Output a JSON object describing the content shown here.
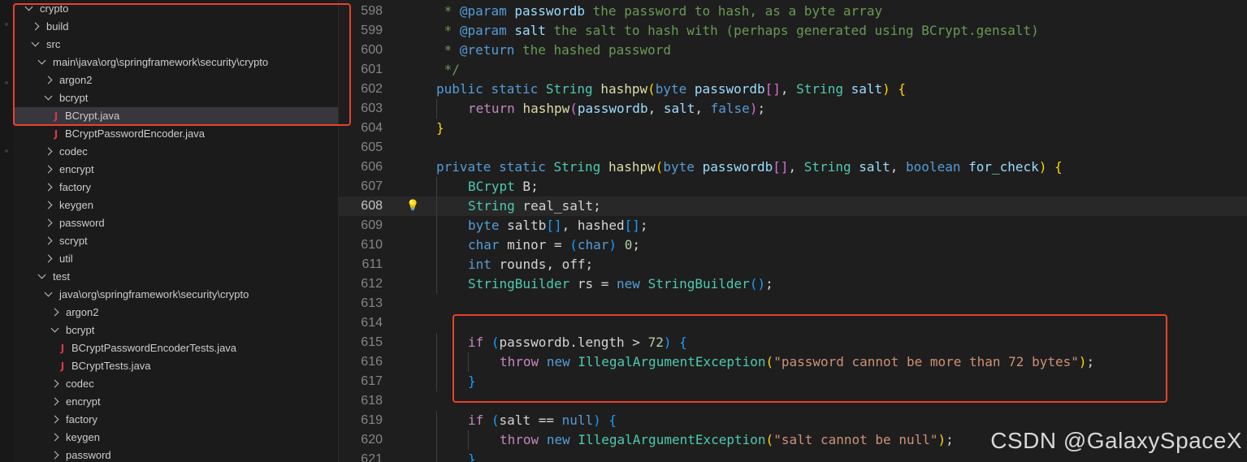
{
  "explorer": {
    "items": [
      {
        "label": "crypto",
        "indent": 0,
        "kind": "folder",
        "open": true
      },
      {
        "label": "build",
        "indent": 1,
        "kind": "folder",
        "open": false
      },
      {
        "label": "src",
        "indent": 1,
        "kind": "folder",
        "open": true
      },
      {
        "label": "main\\java\\org\\springframework\\security\\crypto",
        "indent": 2,
        "kind": "folder",
        "open": true
      },
      {
        "label": "argon2",
        "indent": 3,
        "kind": "folder",
        "open": false
      },
      {
        "label": "bcrypt",
        "indent": 3,
        "kind": "folder",
        "open": true
      },
      {
        "label": "BCrypt.java",
        "indent": 4,
        "kind": "java",
        "selected": true
      },
      {
        "label": "BCryptPasswordEncoder.java",
        "indent": 4,
        "kind": "java"
      },
      {
        "label": "codec",
        "indent": 3,
        "kind": "folder",
        "open": false
      },
      {
        "label": "encrypt",
        "indent": 3,
        "kind": "folder",
        "open": false
      },
      {
        "label": "factory",
        "indent": 3,
        "kind": "folder",
        "open": false
      },
      {
        "label": "keygen",
        "indent": 3,
        "kind": "folder",
        "open": false
      },
      {
        "label": "password",
        "indent": 3,
        "kind": "folder",
        "open": false
      },
      {
        "label": "scrypt",
        "indent": 3,
        "kind": "folder",
        "open": false
      },
      {
        "label": "util",
        "indent": 3,
        "kind": "folder",
        "open": false
      },
      {
        "label": "test",
        "indent": 2,
        "kind": "folder",
        "open": true
      },
      {
        "label": "java\\org\\springframework\\security\\crypto",
        "indent": 3,
        "kind": "folder",
        "open": true
      },
      {
        "label": "argon2",
        "indent": 4,
        "kind": "folder",
        "open": false
      },
      {
        "label": "bcrypt",
        "indent": 4,
        "kind": "folder",
        "open": true
      },
      {
        "label": "BCryptPasswordEncoderTests.java",
        "indent": 5,
        "kind": "java"
      },
      {
        "label": "BCryptTests.java",
        "indent": 5,
        "kind": "java"
      },
      {
        "label": "codec",
        "indent": 4,
        "kind": "folder",
        "open": false
      },
      {
        "label": "encrypt",
        "indent": 4,
        "kind": "folder",
        "open": false
      },
      {
        "label": "factory",
        "indent": 4,
        "kind": "folder",
        "open": false
      },
      {
        "label": "keygen",
        "indent": 4,
        "kind": "folder",
        "open": false
      },
      {
        "label": "password",
        "indent": 4,
        "kind": "folder",
        "open": false
      }
    ]
  },
  "editor": {
    "current_line": 608,
    "lines": [
      {
        "n": 598,
        "indent": 0,
        "tokens": [
          [
            "cmt",
            " * "
          ],
          [
            "tag",
            "@param"
          ],
          [
            "pm",
            " passwordb"
          ],
          [
            "cmt",
            " the password to hash, as a byte array"
          ]
        ]
      },
      {
        "n": 599,
        "indent": 0,
        "tokens": [
          [
            "cmt",
            " * "
          ],
          [
            "tag",
            "@param"
          ],
          [
            "pm",
            " salt"
          ],
          [
            "cmt",
            " the salt to hash with (perhaps generated using BCrypt.gensalt)"
          ]
        ]
      },
      {
        "n": 600,
        "indent": 0,
        "tokens": [
          [
            "cmt",
            " * "
          ],
          [
            "tag",
            "@return"
          ],
          [
            "cmt",
            " the hashed password"
          ]
        ]
      },
      {
        "n": 601,
        "indent": 0,
        "tokens": [
          [
            "cmt",
            " */"
          ]
        ]
      },
      {
        "n": 602,
        "indent": 0,
        "tokens": [
          [
            "kw",
            "public"
          ],
          [
            "pun",
            " "
          ],
          [
            "kw",
            "static"
          ],
          [
            "pun",
            " "
          ],
          [
            "ty",
            "String"
          ],
          [
            "pun",
            " "
          ],
          [
            "fn",
            "hashpw"
          ],
          [
            "b1",
            "("
          ],
          [
            "kw",
            "byte"
          ],
          [
            "pun",
            " "
          ],
          [
            "var",
            "passwordb"
          ],
          [
            "b2",
            "[]"
          ],
          [
            "pun",
            ", "
          ],
          [
            "ty",
            "String"
          ],
          [
            "pun",
            " "
          ],
          [
            "var",
            "salt"
          ],
          [
            "b1",
            ")"
          ],
          [
            "pun",
            " "
          ],
          [
            "b1",
            "{"
          ]
        ]
      },
      {
        "n": 603,
        "indent": 1,
        "tokens": [
          [
            "ctrl",
            "return"
          ],
          [
            "pun",
            " "
          ],
          [
            "fn",
            "hashpw"
          ],
          [
            "b2",
            "("
          ],
          [
            "var",
            "passwordb"
          ],
          [
            "pun",
            ", "
          ],
          [
            "var",
            "salt"
          ],
          [
            "pun",
            ", "
          ],
          [
            "kw",
            "false"
          ],
          [
            "b2",
            ")"
          ],
          [
            "pun",
            ";"
          ]
        ]
      },
      {
        "n": 604,
        "indent": 0,
        "tokens": [
          [
            "b1",
            "}"
          ]
        ]
      },
      {
        "n": 605,
        "indent": 0,
        "tokens": []
      },
      {
        "n": 606,
        "indent": 0,
        "tokens": [
          [
            "kw",
            "private"
          ],
          [
            "pun",
            " "
          ],
          [
            "kw",
            "static"
          ],
          [
            "pun",
            " "
          ],
          [
            "ty",
            "String"
          ],
          [
            "pun",
            " "
          ],
          [
            "fn",
            "hashpw"
          ],
          [
            "b1",
            "("
          ],
          [
            "kw",
            "byte"
          ],
          [
            "pun",
            " "
          ],
          [
            "var",
            "passwordb"
          ],
          [
            "b2",
            "[]"
          ],
          [
            "pun",
            ", "
          ],
          [
            "ty",
            "String"
          ],
          [
            "pun",
            " "
          ],
          [
            "var",
            "salt"
          ],
          [
            "pun",
            ", "
          ],
          [
            "kw",
            "boolean"
          ],
          [
            "pun",
            " "
          ],
          [
            "var",
            "for_check"
          ],
          [
            "b1",
            ")"
          ],
          [
            "pun",
            " "
          ],
          [
            "b1",
            "{"
          ]
        ]
      },
      {
        "n": 607,
        "indent": 1,
        "tokens": [
          [
            "ty",
            "BCrypt"
          ],
          [
            "pun",
            " B;"
          ]
        ]
      },
      {
        "n": 608,
        "indent": 1,
        "tokens": [
          [
            "ty",
            "String"
          ],
          [
            "pun",
            " real_salt;"
          ]
        ]
      },
      {
        "n": 609,
        "indent": 1,
        "tokens": [
          [
            "kw",
            "byte"
          ],
          [
            "pun",
            " saltb"
          ],
          [
            "b3",
            "[]"
          ],
          [
            "pun",
            ", hashed"
          ],
          [
            "b3",
            "[]"
          ],
          [
            "pun",
            ";"
          ]
        ]
      },
      {
        "n": 610,
        "indent": 1,
        "tokens": [
          [
            "kw",
            "char"
          ],
          [
            "pun",
            " minor = "
          ],
          [
            "b3",
            "("
          ],
          [
            "kw",
            "char"
          ],
          [
            "b3",
            ")"
          ],
          [
            "pun",
            " "
          ],
          [
            "num",
            "0"
          ],
          [
            "pun",
            ";"
          ]
        ]
      },
      {
        "n": 611,
        "indent": 1,
        "tokens": [
          [
            "kw",
            "int"
          ],
          [
            "pun",
            " rounds, off;"
          ]
        ]
      },
      {
        "n": 612,
        "indent": 1,
        "tokens": [
          [
            "ty",
            "StringBuilder"
          ],
          [
            "pun",
            " rs = "
          ],
          [
            "kw",
            "new"
          ],
          [
            "pun",
            " "
          ],
          [
            "ty",
            "StringBuilder"
          ],
          [
            "b3",
            "()"
          ],
          [
            "pun",
            ";"
          ]
        ]
      },
      {
        "n": 613,
        "indent": 0,
        "tokens": []
      },
      {
        "n": 614,
        "indent": 0,
        "tokens": []
      },
      {
        "n": 615,
        "indent": 1,
        "tokens": [
          [
            "ctrl",
            "if"
          ],
          [
            "pun",
            " "
          ],
          [
            "b3",
            "("
          ],
          [
            "pun",
            "passwordb.length > "
          ],
          [
            "num",
            "72"
          ],
          [
            "b3",
            ")"
          ],
          [
            "pun",
            " "
          ],
          [
            "b3",
            "{"
          ]
        ]
      },
      {
        "n": 616,
        "indent": 2,
        "tokens": [
          [
            "ctrl",
            "throw"
          ],
          [
            "pun",
            " "
          ],
          [
            "kw",
            "new"
          ],
          [
            "pun",
            " "
          ],
          [
            "ty",
            "IllegalArgumentException"
          ],
          [
            "b1",
            "("
          ],
          [
            "str",
            "\"password cannot be more than 72 bytes\""
          ],
          [
            "b1",
            ")"
          ],
          [
            "pun",
            ";"
          ]
        ]
      },
      {
        "n": 617,
        "indent": 1,
        "tokens": [
          [
            "b3",
            "}"
          ]
        ]
      },
      {
        "n": 618,
        "indent": 0,
        "tokens": []
      },
      {
        "n": 619,
        "indent": 1,
        "tokens": [
          [
            "ctrl",
            "if"
          ],
          [
            "pun",
            " "
          ],
          [
            "b3",
            "("
          ],
          [
            "pun",
            "salt == "
          ],
          [
            "kw",
            "null"
          ],
          [
            "b3",
            ")"
          ],
          [
            "pun",
            " "
          ],
          [
            "b3",
            "{"
          ]
        ]
      },
      {
        "n": 620,
        "indent": 2,
        "tokens": [
          [
            "ctrl",
            "throw"
          ],
          [
            "pun",
            " "
          ],
          [
            "kw",
            "new"
          ],
          [
            "pun",
            " "
          ],
          [
            "ty",
            "IllegalArgumentException"
          ],
          [
            "b1",
            "("
          ],
          [
            "str",
            "\"salt cannot be null\""
          ],
          [
            "b1",
            ")"
          ],
          [
            "pun",
            ";"
          ]
        ]
      },
      {
        "n": 621,
        "indent": 1,
        "tokens": [
          [
            "b3",
            "}"
          ]
        ]
      }
    ]
  },
  "watermark": "CSDN @GalaxySpaceX",
  "colors": {
    "highlight_box": "#e8412c",
    "java_icon": "#d8374b",
    "lightbulb": "#f0c33c"
  },
  "icons": {
    "folder_open": "chevron-down-icon",
    "folder_closed": "chevron-right-icon",
    "java_file": "java-file-icon",
    "hint": "lightbulb-icon"
  }
}
